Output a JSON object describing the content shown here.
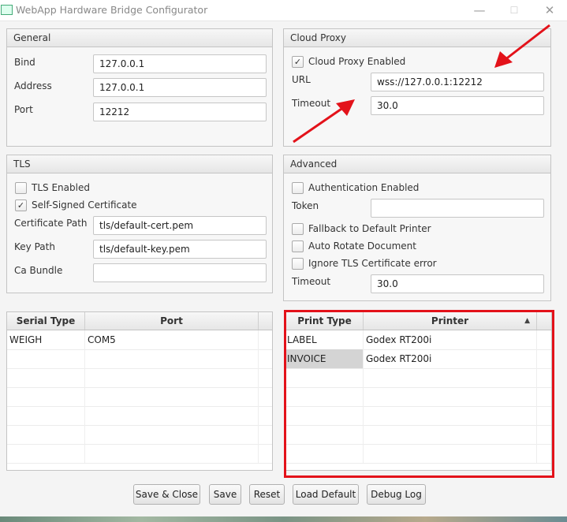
{
  "window": {
    "title": "WebApp Hardware Bridge Configurator",
    "min_glyph": "—",
    "max_glyph": "☐",
    "close_glyph": "✕"
  },
  "general": {
    "header": "General",
    "bind_label": "Bind",
    "bind_value": "127.0.0.1",
    "address_label": "Address",
    "address_value": "127.0.0.1",
    "port_label": "Port",
    "port_value": "12212"
  },
  "cloud_proxy": {
    "header": "Cloud Proxy",
    "enabled_label": "Cloud Proxy Enabled",
    "enabled": true,
    "url_label": "URL",
    "url_value": "wss://127.0.0.1:12212",
    "timeout_label": "Timeout",
    "timeout_value": "30.0"
  },
  "tls": {
    "header": "TLS",
    "tls_enabled_label": "TLS Enabled",
    "tls_enabled": false,
    "self_signed_label": "Self-Signed Certificate",
    "self_signed": true,
    "cert_path_label": "Certificate Path",
    "cert_path_value": "tls/default-cert.pem",
    "key_path_label": "Key Path",
    "key_path_value": "tls/default-key.pem",
    "ca_bundle_label": "Ca Bundle",
    "ca_bundle_value": ""
  },
  "advanced": {
    "header": "Advanced",
    "auth_label": "Authentication Enabled",
    "auth": false,
    "token_label": "Token",
    "token_value": "",
    "fallback_label": "Fallback to Default Printer",
    "fallback": false,
    "rotate_label": "Auto Rotate Document",
    "rotate": false,
    "ignore_tls_label": "Ignore TLS Certificate error",
    "ignore_tls": false,
    "timeout_label": "Timeout",
    "timeout_value": "30.0"
  },
  "serial_table": {
    "headers": [
      "Serial Type",
      "Port"
    ],
    "rows": [
      [
        "WEIGH",
        "COM5"
      ]
    ]
  },
  "print_table": {
    "headers": [
      "Print Type",
      "Printer"
    ],
    "sort_glyph": "▲",
    "rows": [
      [
        "LABEL",
        "Godex RT200i"
      ],
      [
        "INVOICE",
        "Godex RT200i"
      ]
    ]
  },
  "buttons": {
    "save_close": "Save & Close",
    "save": "Save",
    "reset": "Reset",
    "load_default": "Load Default",
    "debug_log": "Debug Log"
  },
  "colors": {
    "annotation_red": "#e3121a",
    "selected_cell": "#d4d4d4"
  },
  "check_glyph": "✓"
}
